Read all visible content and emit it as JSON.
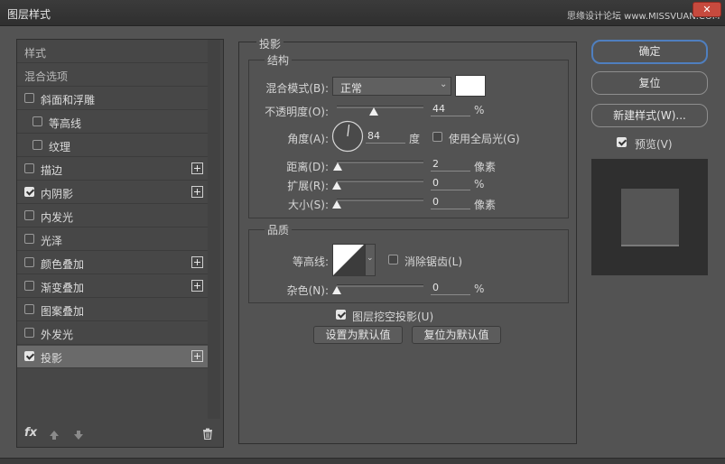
{
  "window": {
    "title": "图层样式",
    "watermark": "思缘设计论坛 www.MISSVUAN.COM"
  },
  "left_panel": {
    "header_styles": "样式",
    "header_blend": "混合选项",
    "items": [
      {
        "label": "斜面和浮雕",
        "checked": false,
        "plus": false
      },
      {
        "label": "等高线",
        "checked": false,
        "plus": false
      },
      {
        "label": "纹理",
        "checked": false,
        "plus": false
      },
      {
        "label": "描边",
        "checked": false,
        "plus": true
      },
      {
        "label": "内阴影",
        "checked": true,
        "plus": true
      },
      {
        "label": "内发光",
        "checked": false,
        "plus": false
      },
      {
        "label": "光泽",
        "checked": false,
        "plus": false
      },
      {
        "label": "颜色叠加",
        "checked": false,
        "plus": true
      },
      {
        "label": "渐变叠加",
        "checked": false,
        "plus": true
      },
      {
        "label": "图案叠加",
        "checked": false,
        "plus": false
      },
      {
        "label": "外发光",
        "checked": false,
        "plus": false
      },
      {
        "label": "投影",
        "checked": true,
        "plus": true
      }
    ],
    "fx_label": "fx"
  },
  "drop_shadow": {
    "section_title": "投影",
    "structure_title": "结构",
    "blend_mode_label": "混合模式(B):",
    "blend_mode_value": "正常",
    "opacity_label": "不透明度(O):",
    "opacity_value": "44",
    "opacity_unit": "%",
    "angle_label": "角度(A):",
    "angle_value": "84",
    "angle_unit": "度",
    "global_light_label": "使用全局光(G)",
    "global_light_checked": false,
    "distance_label": "距离(D):",
    "distance_value": "2",
    "distance_unit": "像素",
    "spread_label": "扩展(R):",
    "spread_value": "0",
    "spread_unit": "%",
    "size_label": "大小(S):",
    "size_value": "0",
    "size_unit": "像素",
    "quality_title": "品质",
    "contour_label": "等高线:",
    "antialias_label": "消除锯齿(L)",
    "antialias_checked": false,
    "noise_label": "杂色(N):",
    "noise_value": "0",
    "noise_unit": "%",
    "knockout_label": "图层挖空投影(U)",
    "knockout_checked": true,
    "make_default_label": "设置为默认值",
    "reset_default_label": "复位为默认值"
  },
  "right_panel": {
    "ok_label": "确定",
    "reset_label": "复位",
    "new_style_label": "新建样式(W)...",
    "preview_label": "预览(V)",
    "preview_checked": true
  },
  "colors": {
    "accent": "#4f7fbf",
    "shadow_color": "#ffffff"
  }
}
